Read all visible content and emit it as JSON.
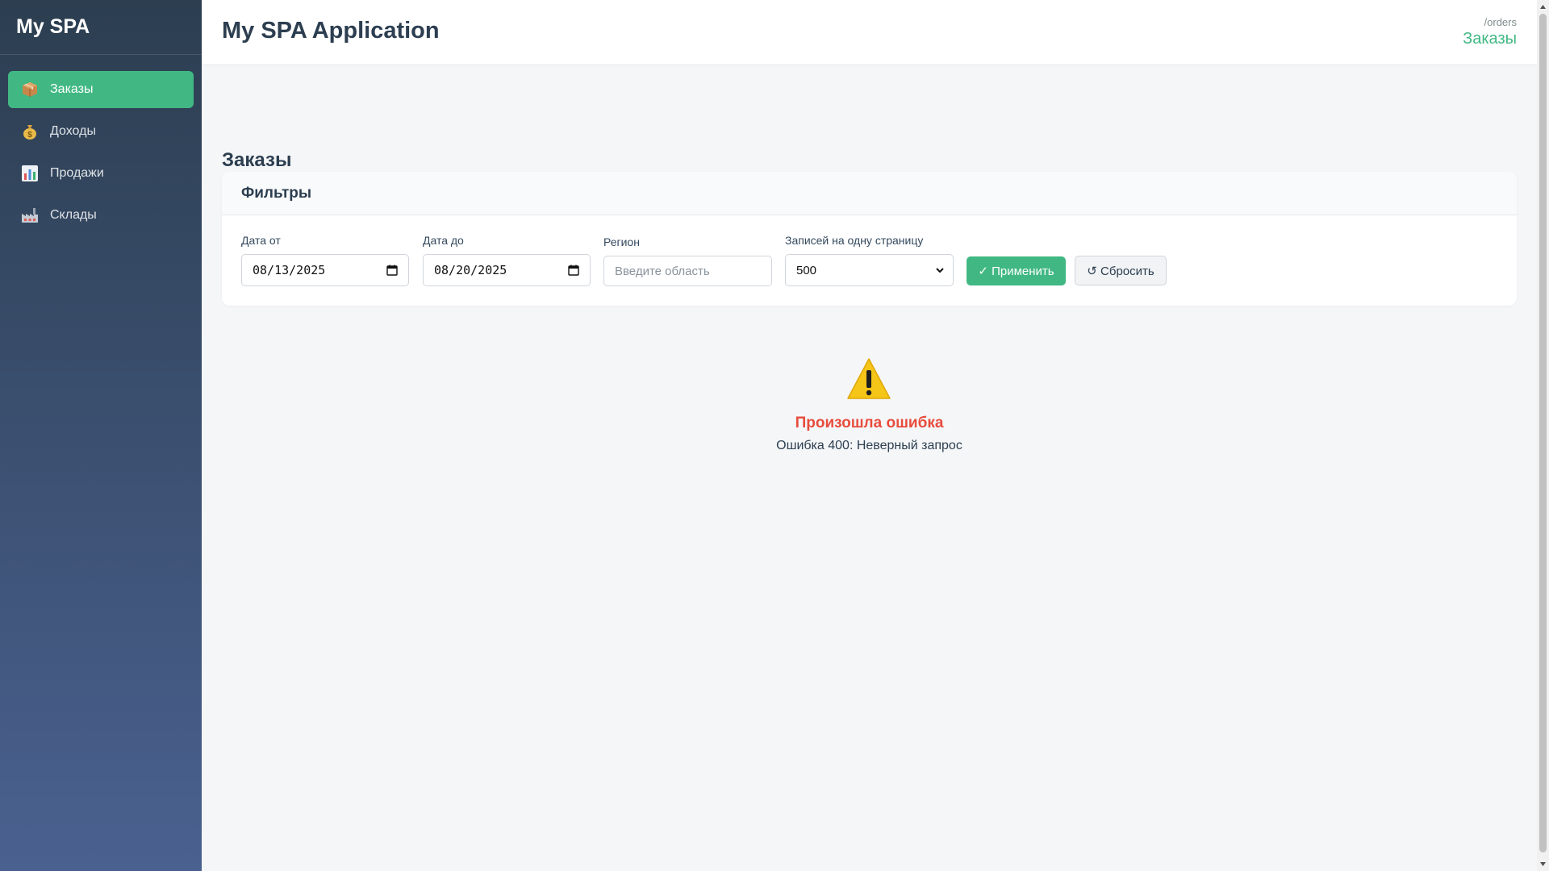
{
  "sidebar": {
    "logo": "My SPA",
    "items": [
      {
        "label": "Заказы",
        "icon": "package-icon",
        "active": true
      },
      {
        "label": "Доходы",
        "icon": "money-bag-icon",
        "active": false
      },
      {
        "label": "Продажи",
        "icon": "bar-chart-icon",
        "active": false
      },
      {
        "label": "Склады",
        "icon": "factory-icon",
        "active": false
      }
    ]
  },
  "header": {
    "title": "My SPA Application",
    "route": "/orders",
    "page": "Заказы"
  },
  "main": {
    "heading": "Заказы",
    "filters": {
      "title": "Фильтры",
      "date_from": {
        "label": "Дата от",
        "value": "08/13/2025"
      },
      "date_to": {
        "label": "Дата до",
        "value": "08/20/2025"
      },
      "region": {
        "label": "Регион",
        "placeholder": "Введите область"
      },
      "per_page": {
        "label": "Записей на одну страницу",
        "value": "500"
      },
      "apply_label": "✓ Применить",
      "reset_label": "↺ Сбросить"
    },
    "error": {
      "icon": "warning-icon",
      "title": "Произошла ошибка",
      "message": "Ошибка 400: Неверный запрос"
    }
  },
  "colors": {
    "accent": "#41b883",
    "error": "#e74c3c",
    "sidebar_top": "#2c3e50",
    "sidebar_bottom": "#4a6190"
  }
}
